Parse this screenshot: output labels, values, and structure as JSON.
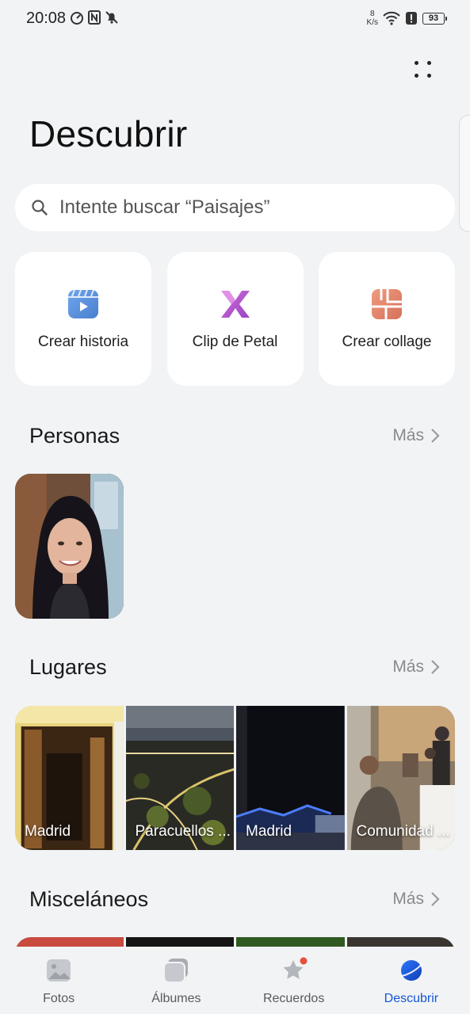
{
  "status_bar": {
    "time": "20:08",
    "net_speed_value": "8",
    "net_speed_unit": "K/s",
    "battery": "93"
  },
  "header": {
    "title": "Descubrir",
    "menu_icon": "more-vertical-icon"
  },
  "search": {
    "placeholder": "Intente buscar “Paisajes”",
    "icon": "search-icon"
  },
  "quick_actions": [
    {
      "label": "Crear historia",
      "icon": "video-story-icon",
      "color": "#5b8fd6"
    },
    {
      "label": "Clip de Petal",
      "icon": "petal-clip-icon",
      "color": "#b457c9"
    },
    {
      "label": "Crear collage",
      "icon": "collage-icon",
      "color": "#e0876d"
    }
  ],
  "sections": {
    "people": {
      "title": "Personas",
      "more": "Más"
    },
    "places": {
      "title": "Lugares",
      "more": "Más"
    },
    "misc": {
      "title": "Misceláneos",
      "more": "Más"
    }
  },
  "places": [
    {
      "label": "Madrid"
    },
    {
      "label": "Paracuellos ..."
    },
    {
      "label": "Madrid"
    },
    {
      "label": "Comunidad ..."
    }
  ],
  "bottom_nav": [
    {
      "label": "Fotos",
      "icon": "photos-icon",
      "active": false
    },
    {
      "label": "Álbumes",
      "icon": "albums-icon",
      "active": false
    },
    {
      "label": "Recuerdos",
      "icon": "memories-star-icon",
      "active": false,
      "badge": true
    },
    {
      "label": "Descubrir",
      "icon": "discover-planet-icon",
      "active": true
    }
  ],
  "colors": {
    "background": "#f1f3f5",
    "accent": "#1455d9",
    "badge": "#e5503b"
  }
}
